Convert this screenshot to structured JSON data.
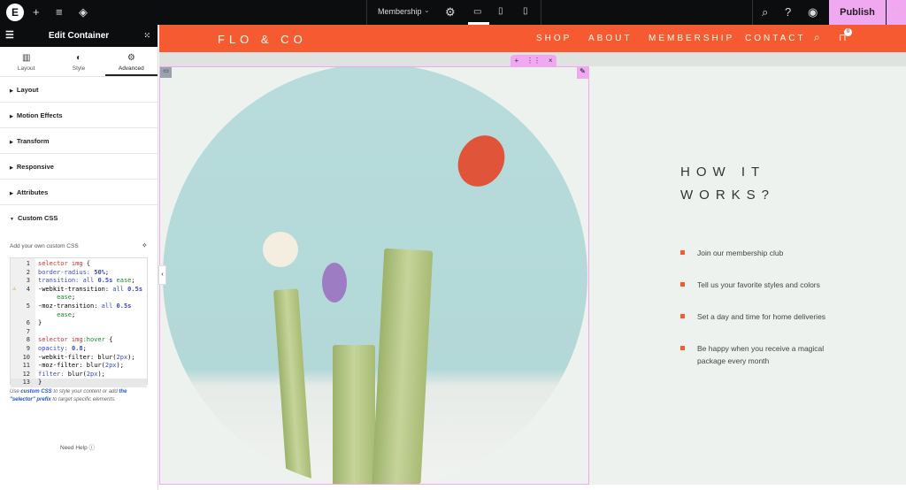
{
  "topbar": {
    "page_name": "Membership",
    "publish_label": "Publish"
  },
  "panel": {
    "title": "Edit Container",
    "tabs": [
      {
        "label": "Layout"
      },
      {
        "label": "Style"
      },
      {
        "label": "Advanced"
      }
    ],
    "sections": [
      {
        "label": "Layout"
      },
      {
        "label": "Motion Effects"
      },
      {
        "label": "Transform"
      },
      {
        "label": "Responsive"
      },
      {
        "label": "Attributes"
      },
      {
        "label": "Custom CSS"
      }
    ],
    "custom_css_label": "Add your own custom CSS",
    "help_pre": "Use ",
    "help_link1": "custom CSS",
    "help_mid": " to style your content or add ",
    "help_link2": "the \"selector\" prefix",
    "help_post": " to target specific elements.",
    "need_help": "Need Help"
  },
  "site": {
    "logo": "FLO & CO",
    "nav": [
      {
        "label": "SHOP"
      },
      {
        "label": "ABOUT"
      },
      {
        "label": "MEMBERSHIP"
      },
      {
        "label": "CONTACT"
      }
    ],
    "cart_count": "0",
    "heading_line1": "HOW IT",
    "heading_line2": "WORKS?",
    "steps": [
      {
        "text": "Join our membership club"
      },
      {
        "text": "Tell us your favorite styles and colors"
      },
      {
        "text": "Set a day and time for home deliveries"
      },
      {
        "text": "Be happy when you receive a magical package every month"
      }
    ],
    "accent": "#f55a31"
  }
}
